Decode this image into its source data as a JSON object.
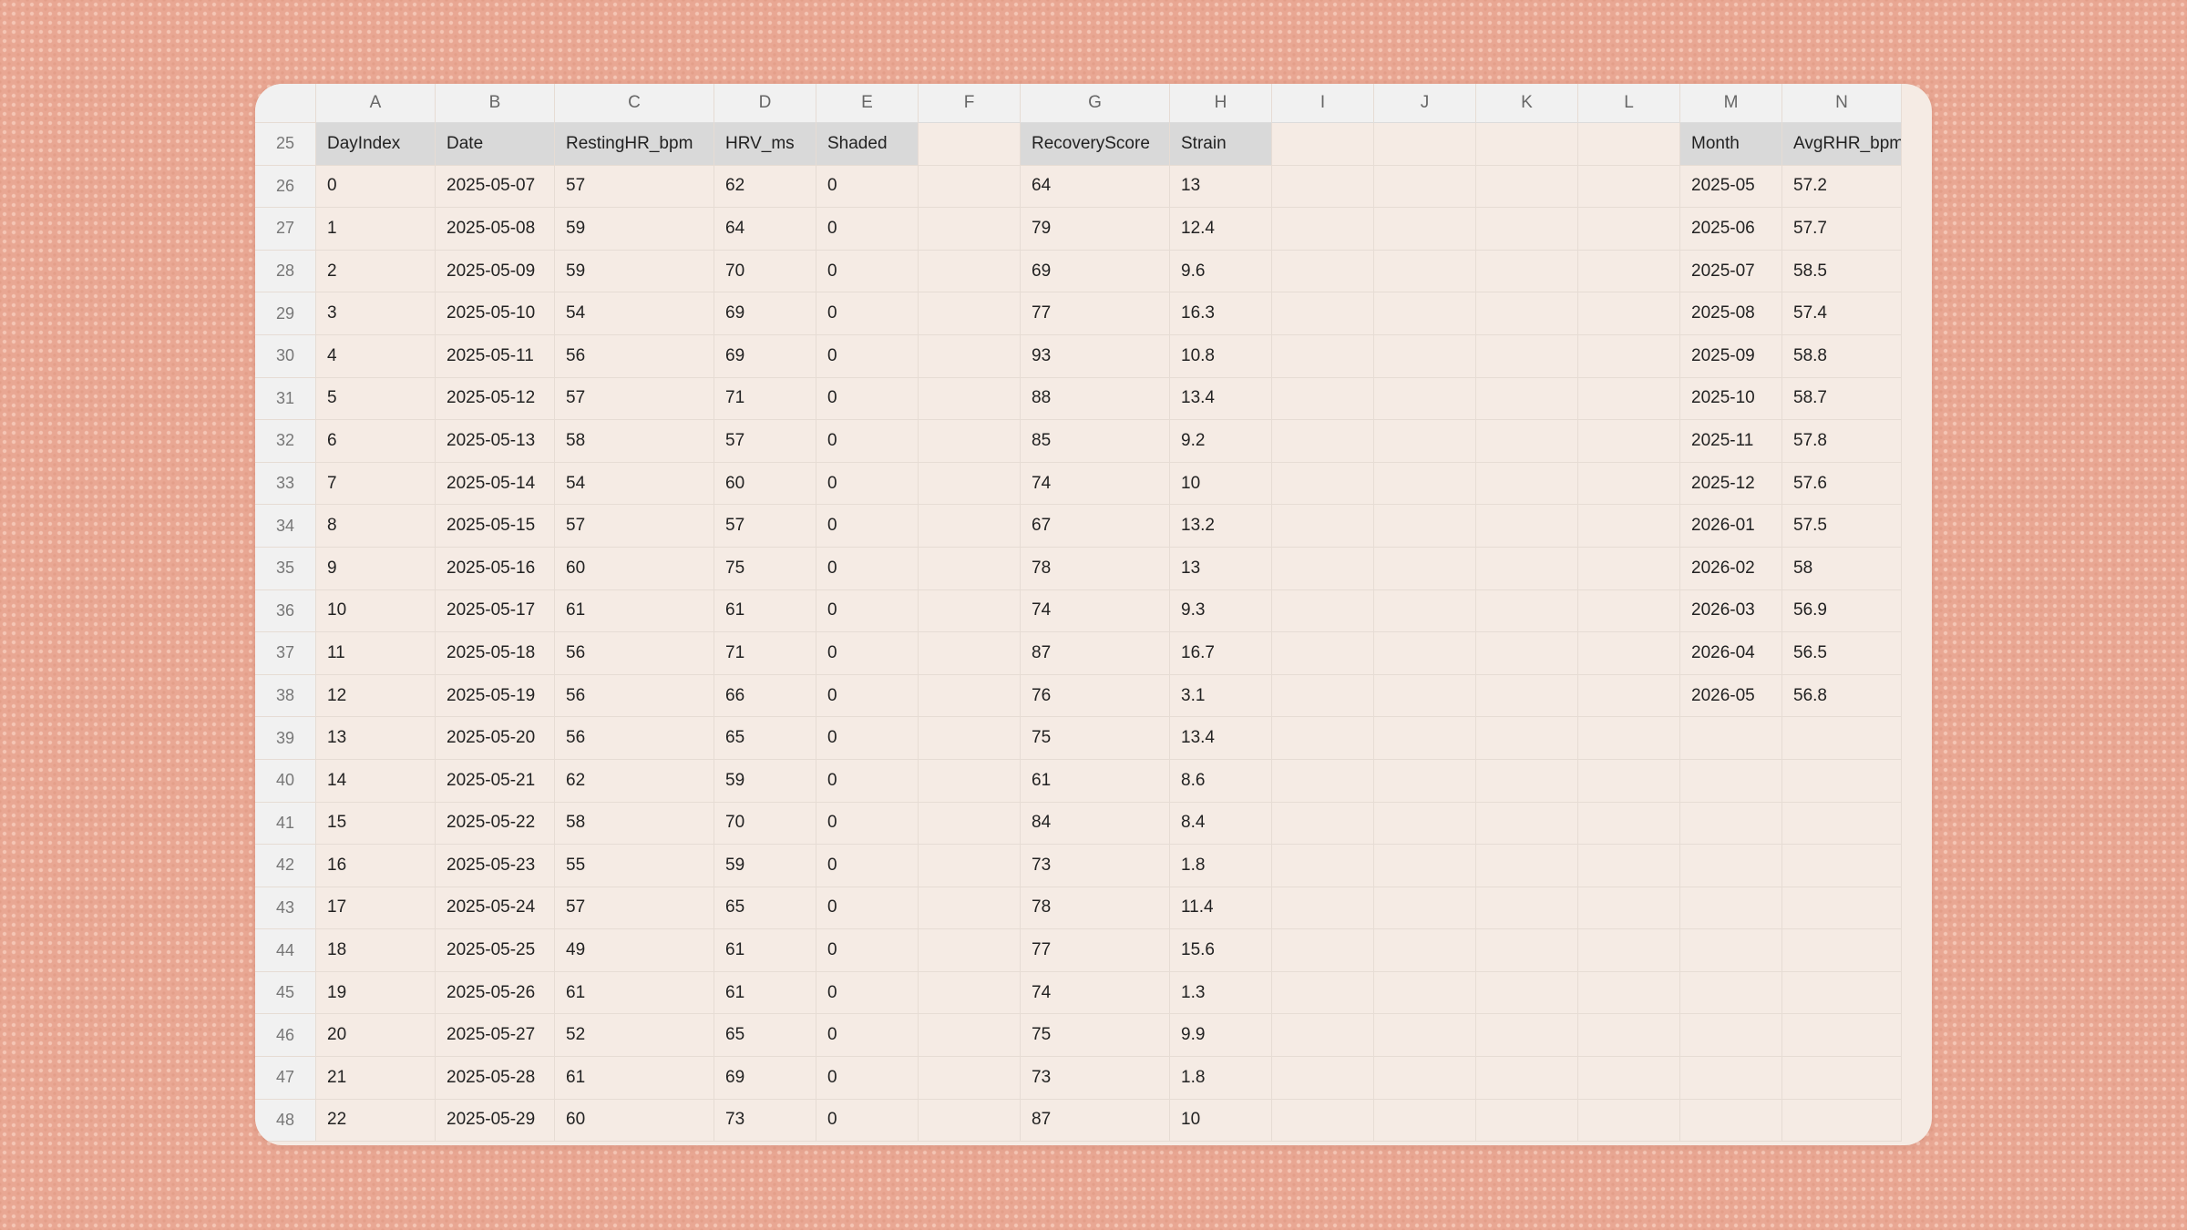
{
  "columns": [
    "A",
    "B",
    "C",
    "D",
    "E",
    "F",
    "G",
    "H",
    "I",
    "J",
    "K",
    "L",
    "M",
    "N"
  ],
  "header_row": {
    "num": "25",
    "cells": [
      "DayIndex",
      "Date",
      "RestingHR_bpm",
      "HRV_ms",
      "Shaded",
      "",
      "RecoveryScore",
      "Strain",
      "",
      "",
      "",
      "",
      "Month",
      "AvgRHR_bpm"
    ]
  },
  "rows": [
    {
      "num": "26",
      "cells": [
        "0",
        "2025-05-07",
        "57",
        "62",
        "0",
        "",
        "64",
        "13",
        "",
        "",
        "",
        "",
        "2025-05",
        "57.2"
      ]
    },
    {
      "num": "27",
      "cells": [
        "1",
        "2025-05-08",
        "59",
        "64",
        "0",
        "",
        "79",
        "12.4",
        "",
        "",
        "",
        "",
        "2025-06",
        "57.7"
      ]
    },
    {
      "num": "28",
      "cells": [
        "2",
        "2025-05-09",
        "59",
        "70",
        "0",
        "",
        "69",
        "9.6",
        "",
        "",
        "",
        "",
        "2025-07",
        "58.5"
      ]
    },
    {
      "num": "29",
      "cells": [
        "3",
        "2025-05-10",
        "54",
        "69",
        "0",
        "",
        "77",
        "16.3",
        "",
        "",
        "",
        "",
        "2025-08",
        "57.4"
      ]
    },
    {
      "num": "30",
      "cells": [
        "4",
        "2025-05-11",
        "56",
        "69",
        "0",
        "",
        "93",
        "10.8",
        "",
        "",
        "",
        "",
        "2025-09",
        "58.8"
      ]
    },
    {
      "num": "31",
      "cells": [
        "5",
        "2025-05-12",
        "57",
        "71",
        "0",
        "",
        "88",
        "13.4",
        "",
        "",
        "",
        "",
        "2025-10",
        "58.7"
      ]
    },
    {
      "num": "32",
      "cells": [
        "6",
        "2025-05-13",
        "58",
        "57",
        "0",
        "",
        "85",
        "9.2",
        "",
        "",
        "",
        "",
        "2025-11",
        "57.8"
      ]
    },
    {
      "num": "33",
      "cells": [
        "7",
        "2025-05-14",
        "54",
        "60",
        "0",
        "",
        "74",
        "10",
        "",
        "",
        "",
        "",
        "2025-12",
        "57.6"
      ]
    },
    {
      "num": "34",
      "cells": [
        "8",
        "2025-05-15",
        "57",
        "57",
        "0",
        "",
        "67",
        "13.2",
        "",
        "",
        "",
        "",
        "2026-01",
        "57.5"
      ]
    },
    {
      "num": "35",
      "cells": [
        "9",
        "2025-05-16",
        "60",
        "75",
        "0",
        "",
        "78",
        "13",
        "",
        "",
        "",
        "",
        "2026-02",
        "58"
      ]
    },
    {
      "num": "36",
      "cells": [
        "10",
        "2025-05-17",
        "61",
        "61",
        "0",
        "",
        "74",
        "9.3",
        "",
        "",
        "",
        "",
        "2026-03",
        "56.9"
      ]
    },
    {
      "num": "37",
      "cells": [
        "11",
        "2025-05-18",
        "56",
        "71",
        "0",
        "",
        "87",
        "16.7",
        "",
        "",
        "",
        "",
        "2026-04",
        "56.5"
      ]
    },
    {
      "num": "38",
      "cells": [
        "12",
        "2025-05-19",
        "56",
        "66",
        "0",
        "",
        "76",
        "3.1",
        "",
        "",
        "",
        "",
        "2026-05",
        "56.8"
      ]
    },
    {
      "num": "39",
      "cells": [
        "13",
        "2025-05-20",
        "56",
        "65",
        "0",
        "",
        "75",
        "13.4",
        "",
        "",
        "",
        "",
        "",
        ""
      ]
    },
    {
      "num": "40",
      "cells": [
        "14",
        "2025-05-21",
        "62",
        "59",
        "0",
        "",
        "61",
        "8.6",
        "",
        "",
        "",
        "",
        "",
        ""
      ]
    },
    {
      "num": "41",
      "cells": [
        "15",
        "2025-05-22",
        "58",
        "70",
        "0",
        "",
        "84",
        "8.4",
        "",
        "",
        "",
        "",
        "",
        ""
      ]
    },
    {
      "num": "42",
      "cells": [
        "16",
        "2025-05-23",
        "55",
        "59",
        "0",
        "",
        "73",
        "1.8",
        "",
        "",
        "",
        "",
        "",
        ""
      ]
    },
    {
      "num": "43",
      "cells": [
        "17",
        "2025-05-24",
        "57",
        "65",
        "0",
        "",
        "78",
        "11.4",
        "",
        "",
        "",
        "",
        "",
        ""
      ]
    },
    {
      "num": "44",
      "cells": [
        "18",
        "2025-05-25",
        "49",
        "61",
        "0",
        "",
        "77",
        "15.6",
        "",
        "",
        "",
        "",
        "",
        ""
      ]
    },
    {
      "num": "45",
      "cells": [
        "19",
        "2025-05-26",
        "61",
        "61",
        "0",
        "",
        "74",
        "1.3",
        "",
        "",
        "",
        "",
        "",
        ""
      ]
    },
    {
      "num": "46",
      "cells": [
        "20",
        "2025-05-27",
        "52",
        "65",
        "0",
        "",
        "75",
        "9.9",
        "",
        "",
        "",
        "",
        "",
        ""
      ]
    },
    {
      "num": "47",
      "cells": [
        "21",
        "2025-05-28",
        "61",
        "69",
        "0",
        "",
        "73",
        "1.8",
        "",
        "",
        "",
        "",
        "",
        ""
      ]
    },
    {
      "num": "48",
      "cells": [
        "22",
        "2025-05-29",
        "60",
        "73",
        "0",
        "",
        "87",
        "10",
        "",
        "",
        "",
        "",
        "",
        ""
      ]
    }
  ]
}
